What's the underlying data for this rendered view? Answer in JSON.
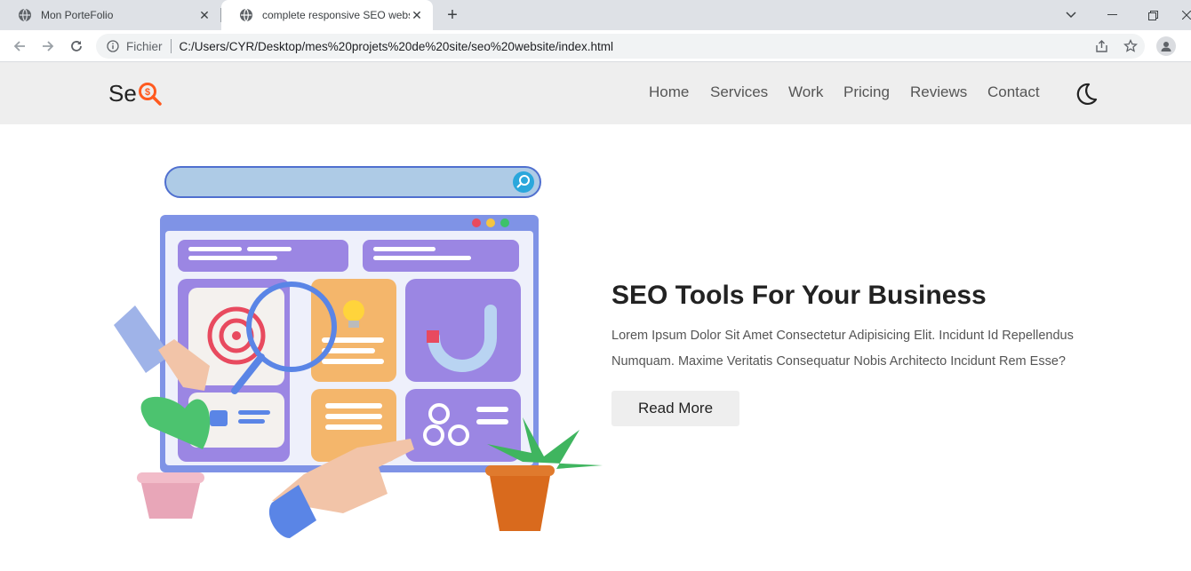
{
  "browser": {
    "tabs": [
      {
        "title": "Mon PorteFolio",
        "active": false
      },
      {
        "title": "complete responsive SEO website",
        "active": true
      }
    ],
    "address": {
      "scheme_label": "Fichier",
      "url": "C:/Users/CYR/Desktop/mes%20projets%20de%20site/seo%20website/index.html"
    }
  },
  "site": {
    "logo_text": "Se",
    "nav": [
      "Home",
      "Services",
      "Work",
      "Pricing",
      "Reviews",
      "Contact"
    ],
    "hero": {
      "title": "SEO Tools For Your Business",
      "description_line1": "Lorem Ipsum Dolor Sit Amet Consectetur Adipisicing Elit. Incidunt Id Repellendus",
      "description_line2": "Numquam. Maxime Veritatis Consequatur Nobis Architecto Incidunt Rem Esse?",
      "button_label": "Read More"
    }
  },
  "colors": {
    "accent": "#ff5a1f",
    "header_bg": "#eeeeee",
    "tabbar_bg": "#dee1e6"
  }
}
